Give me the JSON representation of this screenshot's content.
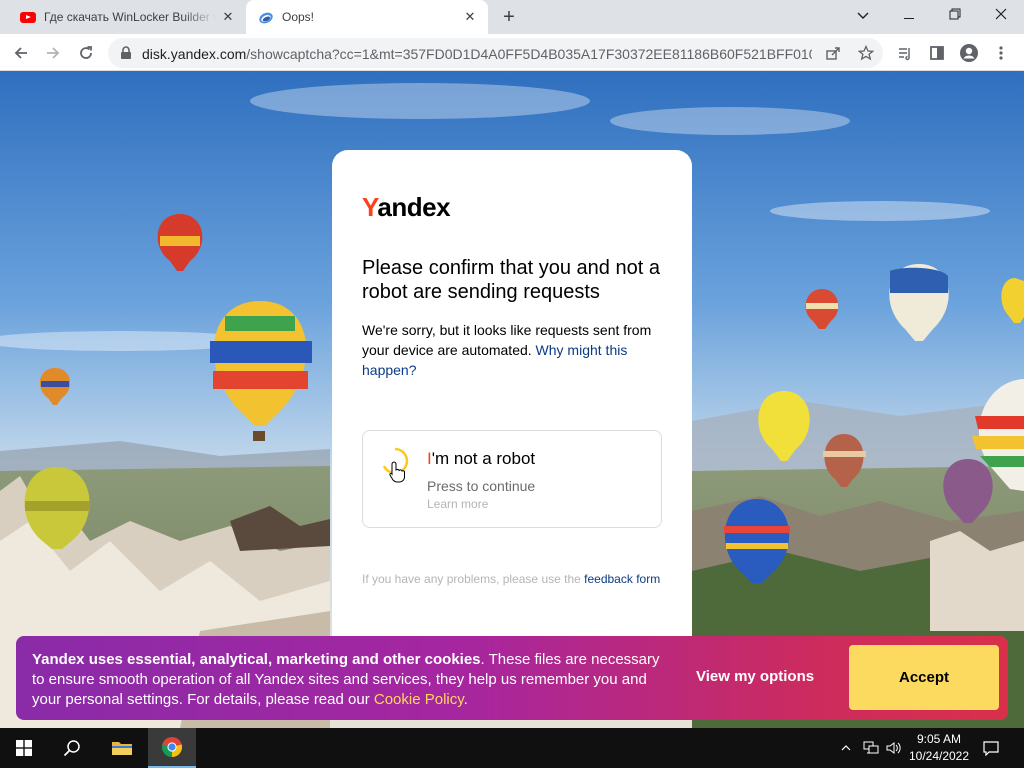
{
  "browser": {
    "tabs": [
      {
        "title": "Где скачать WinLocker Builder v",
        "icon": "youtube-icon"
      },
      {
        "title": "Oops!",
        "icon": "yandex-disk-icon"
      }
    ],
    "url_host": "disk.yandex.com",
    "url_rest": "/showcaptcha?cc=1&mt=357FD0D1D4A0FF5D4B035A17F30372EE81186B60F521BFF010F6...",
    "colors": {
      "tabstrip": "#dee1e6",
      "toolbar": "#ffffff",
      "omnibox": "#f1f3f4"
    }
  },
  "card": {
    "logo_first": "Y",
    "logo_rest": "andex",
    "headline": "Please confirm that you and not a robot are sending requests",
    "description": "We're sorry, but it looks like requests sent from your device are automated.",
    "description_link": "Why might this happen?",
    "captcha": {
      "title_first": "I",
      "title_rest": "'m not a robot",
      "subtitle": "Press to continue",
      "learn_more": "Learn more"
    },
    "hint": "If you have any problems, please use the",
    "hint_link": "feedback form"
  },
  "cookie_banner": {
    "bold": "Yandex uses essential, analytical, marketing and other cookies",
    "text": ". These files are necessary to ensure smooth operation of all Yandex sites and services, they help us remember you and your personal settings. For details, please read our ",
    "link": "Cookie Policy",
    "end": ".",
    "view_options": "View my options",
    "accept": "Accept",
    "colors": {
      "accept": "#fcd95f",
      "link": "#ffd75a",
      "brand_red": "#fc3f1d"
    }
  },
  "taskbar": {
    "time": "9:05 AM",
    "date": "10/24/2022"
  }
}
